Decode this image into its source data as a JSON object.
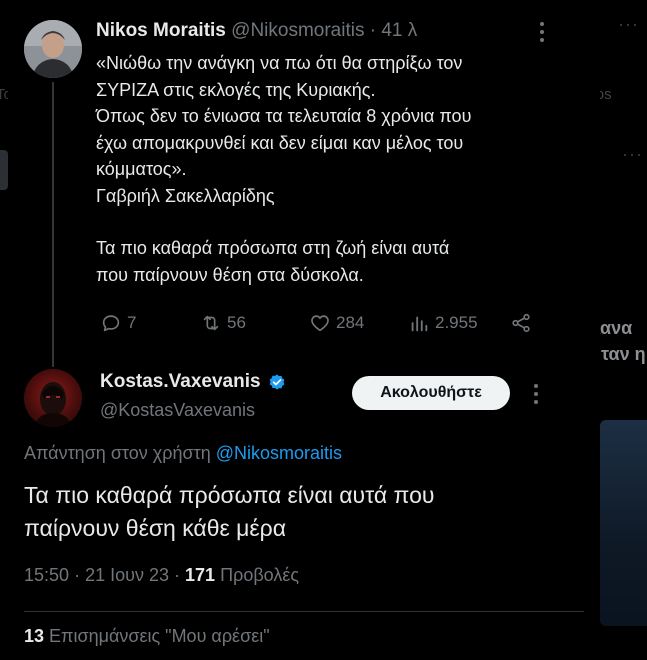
{
  "background": {
    "left_fragment": "Το",
    "tab_videos": "Videos",
    "side_text_1": "ου έκανα",
    "side_text_2": "ήταν η"
  },
  "tweet1": {
    "name": "Nikos Moraitis",
    "handle": "@Nikosmoraitis",
    "dot": "·",
    "time": "41 λ",
    "lines": [
      "«Νιώθω την ανάγκη να πω ότι θα στηρίξω τον",
      "ΣΥΡΙΖΑ στις εκλογές της Κυριακής.",
      "Όπως δεν το ένιωσα τα τελευταία 8 χρόνια που",
      "έχω απομακρυνθεί και δεν είμαι καν μέλος του",
      "κόμματος».",
      "Γαβριήλ Σακελλαρίδης",
      "",
      "Τα πιο καθαρά πρόσωπα στη ζωή είναι αυτά",
      "που παίρνουν θέση στα δύσκολα."
    ],
    "actions": {
      "replies": "7",
      "reposts": "56",
      "likes": "284",
      "views": "2.955"
    }
  },
  "tweet2": {
    "name": "Kostas.Vaxevanis",
    "handle": "@KostasVaxevanis",
    "follow_label": "Ακολουθήστε",
    "reply_prefix": "Απάντηση στον χρήστη",
    "reply_mention": "@Nikosmoraitis",
    "text_line_1": "Τα πιο καθαρά πρόσωπα είναι αυτά που",
    "text_line_2": "παίρνουν θέση κάθε μέρα",
    "time": "15:50",
    "date": "21 Ιουν 23",
    "views_count": "171",
    "views_label": "Προβολές",
    "likes_count": "13",
    "likes_label": "Επισημάνσεις \"Μου αρέσει\""
  },
  "colors": {
    "background": "#000000",
    "text_primary": "#e7e9ea",
    "text_secondary": "#71767b",
    "accent": "#1d9bf0",
    "follow_button_bg": "#eff3f4"
  },
  "icons": {
    "reply": "reply-icon",
    "repost": "repost-icon",
    "like": "heart-icon",
    "views": "views-bar-icon",
    "share": "share-icon",
    "more": "more-dots-icon",
    "verified": "verified-badge-icon"
  }
}
